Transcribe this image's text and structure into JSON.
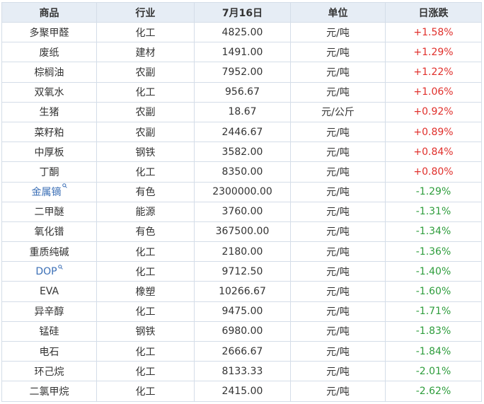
{
  "columns": [
    "商品",
    "行业",
    "7月16日",
    "单位",
    "日涨跌"
  ],
  "colors": {
    "header_bg": "#e6edf5",
    "border": "#d4dde8",
    "rise": "#e0302c",
    "fall": "#2e9d3c",
    "link": "#3b6fb6"
  },
  "rows": [
    {
      "name": "多聚甲醛",
      "industry": "化工",
      "price": "4825.00",
      "unit": "元/吨",
      "change": "+1.58%",
      "dir": "up",
      "link": false
    },
    {
      "name": "废纸",
      "industry": "建材",
      "price": "1491.00",
      "unit": "元/吨",
      "change": "+1.29%",
      "dir": "up",
      "link": false
    },
    {
      "name": "棕榈油",
      "industry": "农副",
      "price": "7952.00",
      "unit": "元/吨",
      "change": "+1.22%",
      "dir": "up",
      "link": false
    },
    {
      "name": "双氧水",
      "industry": "化工",
      "price": "956.67",
      "unit": "元/吨",
      "change": "+1.06%",
      "dir": "up",
      "link": false
    },
    {
      "name": "生猪",
      "industry": "农副",
      "price": "18.67",
      "unit": "元/公斤",
      "change": "+0.92%",
      "dir": "up",
      "link": false
    },
    {
      "name": "菜籽粕",
      "industry": "农副",
      "price": "2446.67",
      "unit": "元/吨",
      "change": "+0.89%",
      "dir": "up",
      "link": false
    },
    {
      "name": "中厚板",
      "industry": "钢铁",
      "price": "3582.00",
      "unit": "元/吨",
      "change": "+0.84%",
      "dir": "up",
      "link": false
    },
    {
      "name": "丁酮",
      "industry": "化工",
      "price": "8350.00",
      "unit": "元/吨",
      "change": "+0.80%",
      "dir": "up",
      "link": false
    },
    {
      "name": "金属镝",
      "industry": "有色",
      "price": "2300000.00",
      "unit": "元/吨",
      "change": "-1.29%",
      "dir": "down",
      "link": true
    },
    {
      "name": "二甲醚",
      "industry": "能源",
      "price": "3760.00",
      "unit": "元/吨",
      "change": "-1.31%",
      "dir": "down",
      "link": false
    },
    {
      "name": "氧化镨",
      "industry": "有色",
      "price": "367500.00",
      "unit": "元/吨",
      "change": "-1.34%",
      "dir": "down",
      "link": false
    },
    {
      "name": "重质纯碱",
      "industry": "化工",
      "price": "2180.00",
      "unit": "元/吨",
      "change": "-1.36%",
      "dir": "down",
      "link": false
    },
    {
      "name": "DOP",
      "industry": "化工",
      "price": "9712.50",
      "unit": "元/吨",
      "change": "-1.40%",
      "dir": "down",
      "link": true
    },
    {
      "name": "EVA",
      "industry": "橡塑",
      "price": "10266.67",
      "unit": "元/吨",
      "change": "-1.60%",
      "dir": "down",
      "link": false
    },
    {
      "name": "异辛醇",
      "industry": "化工",
      "price": "9475.00",
      "unit": "元/吨",
      "change": "-1.71%",
      "dir": "down",
      "link": false
    },
    {
      "name": "锰硅",
      "industry": "钢铁",
      "price": "6980.00",
      "unit": "元/吨",
      "change": "-1.83%",
      "dir": "down",
      "link": false
    },
    {
      "name": "电石",
      "industry": "化工",
      "price": "2666.67",
      "unit": "元/吨",
      "change": "-1.84%",
      "dir": "down",
      "link": false
    },
    {
      "name": "环己烷",
      "industry": "化工",
      "price": "8133.33",
      "unit": "元/吨",
      "change": "-2.01%",
      "dir": "down",
      "link": false
    },
    {
      "name": "二氯甲烷",
      "industry": "化工",
      "price": "2415.00",
      "unit": "元/吨",
      "change": "-2.62%",
      "dir": "down",
      "link": false
    }
  ]
}
